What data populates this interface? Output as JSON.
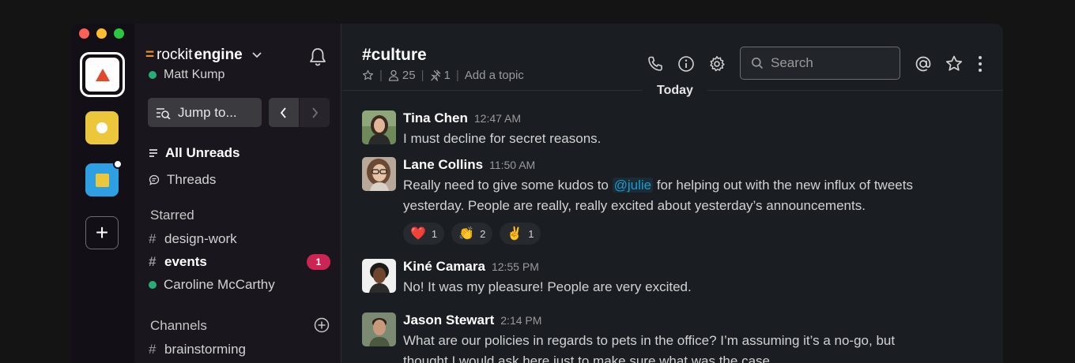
{
  "workspace": {
    "name_part1": "rockit",
    "name_part2": "engine",
    "user": "Matt Kump",
    "add_label": "+"
  },
  "sidebar": {
    "jump_label": "Jump to...",
    "all_unreads": "All Unreads",
    "threads": "Threads",
    "starred_title": "Starred",
    "starred": [
      {
        "name": "design-work",
        "bold": false
      },
      {
        "name": "events",
        "bold": true,
        "badge": "1"
      },
      {
        "name": "Caroline McCarthy",
        "type": "dm"
      }
    ],
    "channels_title": "Channels",
    "channels": [
      {
        "name": "brainstorming"
      }
    ]
  },
  "channel": {
    "title": "#culture",
    "members": "25",
    "pins": "1",
    "topic": "Add a topic"
  },
  "search": {
    "placeholder": "Search"
  },
  "date_divider": "Today",
  "messages": [
    {
      "name": "Tina Chen",
      "time": "12:47 AM",
      "text": "I must decline for secret reasons."
    },
    {
      "name": "Lane Collins",
      "time": "11:50 AM",
      "text_before": "Really need to give some kudos to ",
      "mention": "@julie",
      "text_after": " for helping out with the new influx of tweets yesterday. People are really, really excited about yesterday’s announcements.",
      "reactions": [
        {
          "emoji": "❤️",
          "count": "1"
        },
        {
          "emoji": "👏",
          "count": "2"
        },
        {
          "emoji": "✌️",
          "count": "1"
        }
      ]
    },
    {
      "name": "Kiné Camara",
      "time": "12:55 PM",
      "text": "No! It was my pleasure! People are very excited."
    },
    {
      "name": "Jason Stewart",
      "time": "2:14 PM",
      "text": "What are our policies in regards to pets in the office? I’m assuming it’s a no-go, but thought I would ask here just to make sure what was the case."
    }
  ],
  "colors": {
    "accent": "#1d9bd1",
    "badge": "#cd2553",
    "presence": "#2bac76",
    "brand": "#e8912d"
  }
}
